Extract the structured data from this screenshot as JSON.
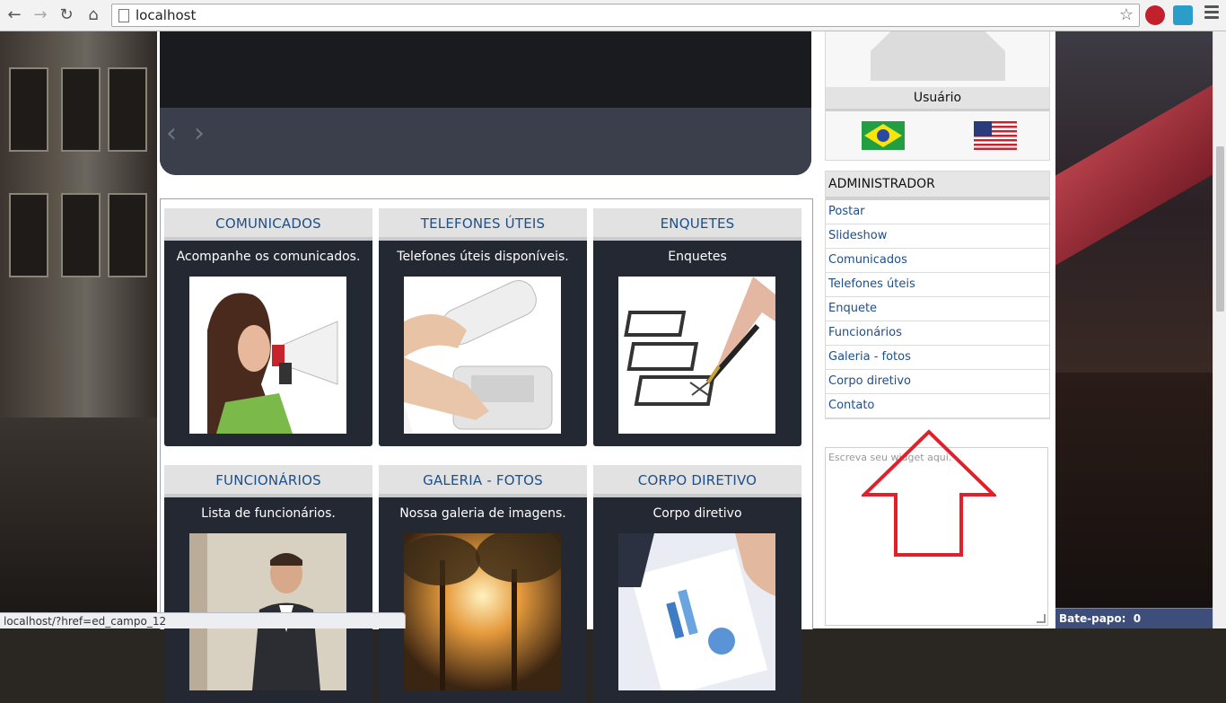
{
  "browser": {
    "url": "localhost",
    "status_url": "localhost/?href=ed_campo_12",
    "icons": [
      "back-arrow-icon",
      "forward-arrow-icon",
      "reload-icon",
      "home-icon",
      "page-icon",
      "star-icon",
      "adblock-extension-icon",
      "extension-icon",
      "menu-icon"
    ]
  },
  "cards": [
    {
      "title": "COMUNICADOS",
      "desc": "Acompanhe os comunicados."
    },
    {
      "title": "TELEFONES ÚTEIS",
      "desc": "Telefones úteis disponíveis."
    },
    {
      "title": "ENQUETES",
      "desc": "Enquetes"
    },
    {
      "title": "FUNCIONÁRIOS",
      "desc": "Lista de funcionários."
    },
    {
      "title": "GALERIA - FOTOS",
      "desc": "Nossa galeria de imagens."
    },
    {
      "title": "CORPO DIRETIVO",
      "desc": "Corpo diretivo"
    }
  ],
  "user_panel": {
    "label": "Usuário"
  },
  "admin": {
    "title": "ADMINISTRADOR",
    "items": [
      "Postar",
      "Slideshow",
      "Comunicados",
      "Telefones úteis",
      "Enquete",
      "Funcionários",
      "Galeria - fotos",
      "Corpo diretivo",
      "Contato"
    ]
  },
  "widget": {
    "placeholder": "Escreva seu widget aqui."
  },
  "chat": {
    "label": "Bate-papo:",
    "count": "0"
  },
  "colors": {
    "accent_link": "#1d4f8a",
    "card_body": "#232832",
    "chat_bar": "#3d4e7a",
    "annotation_arrow": "#e0202a"
  }
}
